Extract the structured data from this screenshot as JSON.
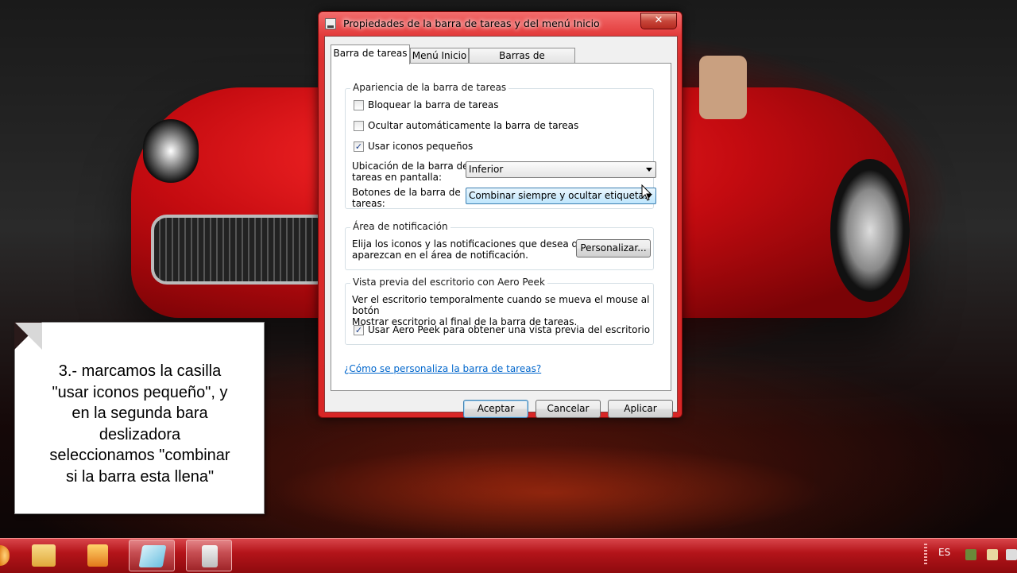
{
  "window": {
    "title": "Propiedades de la barra de tareas y del menú Inicio",
    "close_label": "✕"
  },
  "tabs": [
    {
      "label": "Barra de tareas",
      "active": true
    },
    {
      "label": "Menú Inicio",
      "active": false
    },
    {
      "label": "Barras de herramientas",
      "active": false
    }
  ],
  "appearance": {
    "title": "Apariencia de la barra de tareas",
    "lock_label": "Bloquear la barra de tareas",
    "lock_checked": false,
    "autohide_label": "Ocultar automáticamente la barra de tareas",
    "autohide_checked": false,
    "small_icons_label": "Usar iconos pequeños",
    "small_icons_checked": true,
    "location_label_1": "Ubicación de la barra de",
    "location_label_2": "tareas en pantalla:",
    "location_value": "Inferior",
    "buttons_label_1": "Botones de la barra de",
    "buttons_label_2": "tareas:",
    "buttons_value": "Combinar siempre y ocultar etiquetas"
  },
  "notification": {
    "title": "Área de notificación",
    "desc_1": "Elija los iconos y las notificaciones que desea que",
    "desc_2": "aparezcan en el área de notificación.",
    "customize_label": "Personalizar..."
  },
  "aero_peek": {
    "title": "Vista previa del escritorio con Aero Peek",
    "desc_1": "Ver el escritorio temporalmente cuando se mueva el mouse al botón",
    "desc_2": "Mostrar escritorio al final de la barra de tareas.",
    "checkbox_label": "Usar Aero Peek para obtener una vista previa del escritorio",
    "checkbox_checked": true
  },
  "help_link": "¿Cómo se personaliza la barra de tareas?",
  "buttons": {
    "ok": "Aceptar",
    "cancel": "Cancelar",
    "apply": "Aplicar"
  },
  "check_glyph": "✓",
  "note": {
    "line1": "3.- marcamos la casilla",
    "line2": "\"usar iconos pequeño\", y",
    "line3": "en la segunda bara",
    "line4": "deslizadora",
    "line5": "seleccionamos \"combinar",
    "line6": "si la barra esta llena\""
  },
  "taskbar": {
    "apps": [
      {
        "icon": "explorer-folder-icon",
        "color": "#f2c14e"
      },
      {
        "icon": "media-player-icon",
        "color": "#f5a623"
      },
      {
        "icon": "ruler-app-icon",
        "color": "#8fd0e8"
      },
      {
        "icon": "taskbar-properties-icon",
        "color": "#dddddd"
      }
    ],
    "language": "ES"
  },
  "colors": {
    "title_bar": "#dc3030",
    "taskbar": "#b4141a",
    "link": "#0066cc"
  }
}
